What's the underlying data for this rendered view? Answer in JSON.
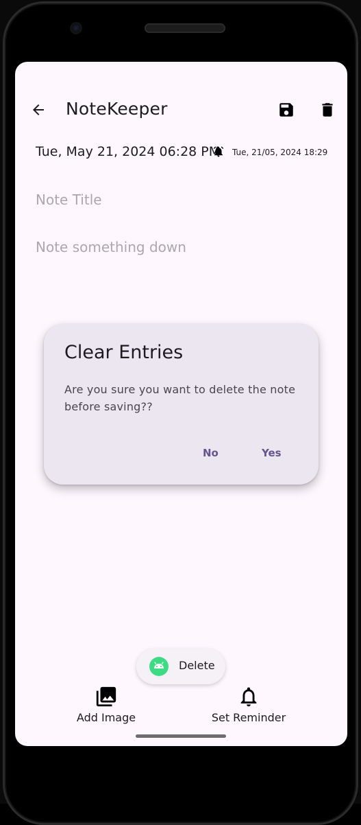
{
  "app_bar": {
    "title": "NoteKeeper",
    "back_icon": "arrow-back-icon",
    "save_icon": "save-icon",
    "delete_icon": "delete-icon"
  },
  "note": {
    "date": "Tue, May 21, 2024 06:28 PM",
    "reminder_icon": "alarm-icon",
    "reminder": "Tue, 21/05, 2024 18:29",
    "title_value": "",
    "title_placeholder": "Note Title",
    "body_value": "",
    "body_placeholder": "Note something down"
  },
  "dialog": {
    "title": "Clear Entries",
    "message": "Are you sure you want to delete the note before saving??",
    "no_label": "No",
    "yes_label": "Yes"
  },
  "toast": {
    "icon": "android-icon",
    "text": "Delete"
  },
  "bottom_bar": {
    "add_image_label": "Add Image",
    "add_image_icon": "photo-library-icon",
    "set_reminder_label": "Set Reminder",
    "set_reminder_icon": "bell-icon"
  },
  "colors": {
    "background": "#fef7fe",
    "dialog_surface": "#ece6f0",
    "dialog_button": "#65558f",
    "placeholder": "#aaa7ae",
    "android_green": "#3ddc84"
  }
}
